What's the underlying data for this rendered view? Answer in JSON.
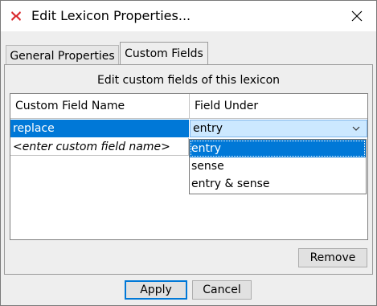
{
  "window": {
    "title": "Edit Lexicon Properties..."
  },
  "tabs": [
    {
      "label": "General Properties",
      "selected": false
    },
    {
      "label": "Custom Fields",
      "selected": true
    }
  ],
  "panel": {
    "heading": "Edit custom fields of this lexicon",
    "table": {
      "columns": [
        "Custom Field Name",
        "Field Under"
      ],
      "rows": [
        {
          "name": "replace",
          "field_under": "entry",
          "selected": true
        },
        {
          "name": "<enter custom field name>",
          "field_under": "",
          "placeholder": true
        }
      ]
    },
    "dropdown": {
      "options": [
        "entry",
        "sense",
        "entry & sense"
      ],
      "selected": "entry"
    },
    "remove_label": "Remove"
  },
  "buttons": {
    "apply": "Apply",
    "cancel": "Cancel"
  },
  "colors": {
    "selection": "#0078d7",
    "combo_bg": "#cce8ff",
    "app_icon": "#d9262a"
  },
  "icons": {
    "app": "app-logo-icon",
    "close": "close-icon",
    "dropdown": "chevron-down-icon"
  }
}
